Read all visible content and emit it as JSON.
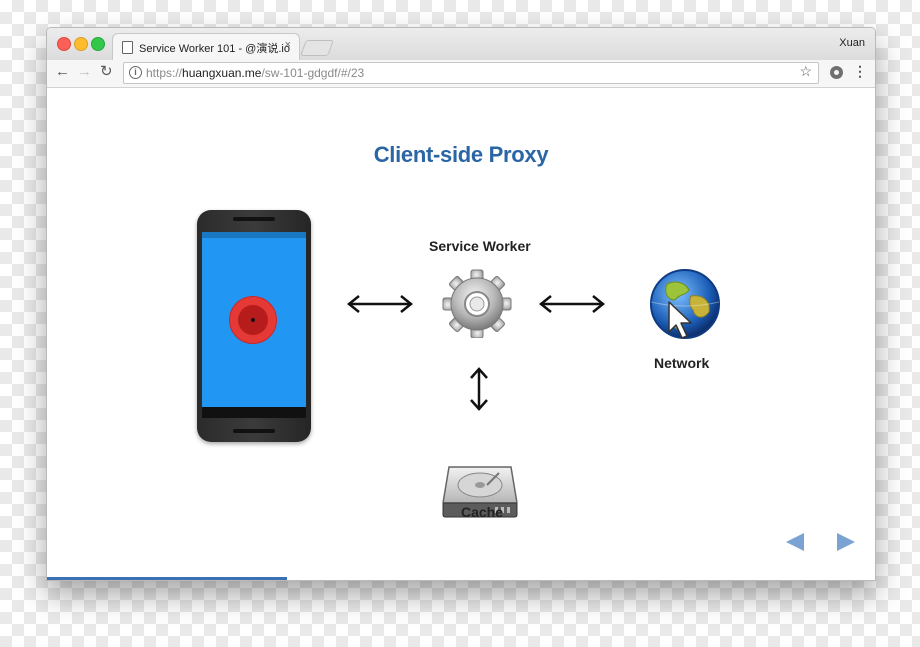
{
  "browser": {
    "tab_title": "Service Worker 101 - @演说.io",
    "tab_close": "×",
    "profile_name": "Xuan",
    "url_scheme": "https://",
    "url_host": "huangxuan.me",
    "url_path": "/sw-101-gdgdf/#/23",
    "nav_back": "←",
    "nav_forward": "→",
    "nav_reload": "↻",
    "info_icon": "i",
    "star_icon": "☆",
    "menu_icon": "⋮"
  },
  "slide": {
    "title": "Client-side Proxy",
    "service_worker_label": "Service Worker",
    "network_label": "Network",
    "cache_label": "Cache",
    "progress": 0.29
  },
  "colors": {
    "title": "#2a66a6",
    "nav_arrows": "#7aa3d4",
    "progress": "#3a71b3",
    "phone_screen": "#2196f3",
    "record_button": "#e53935"
  },
  "icons": {
    "phone": "android-phone-icon",
    "service_worker": "gear-icon",
    "network": "globe-cursor-icon",
    "cache": "hard-drive-icon"
  }
}
